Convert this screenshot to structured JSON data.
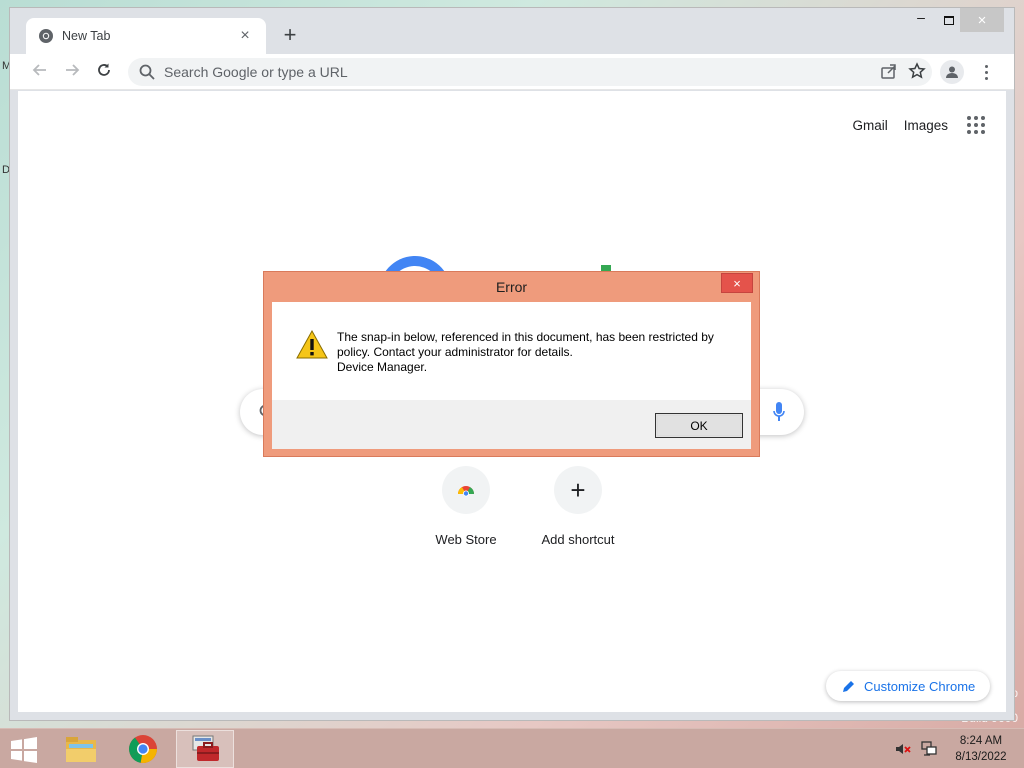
{
  "desktop": {
    "fragment_top": "M",
    "fragment_mid": "D",
    "watermark_side": "p",
    "watermark_build": "Build 9600"
  },
  "browser": {
    "tab_title": "New Tab",
    "tab_close": "×",
    "newtab_symbol": "+",
    "window_controls": {
      "minimize": "–",
      "close": "×"
    },
    "omnibox_placeholder": "Search Google or type a URL",
    "top_links": {
      "gmail": "Gmail",
      "images": "Images"
    },
    "shortcuts": [
      {
        "label": "Web Store"
      },
      {
        "label": "Add shortcut",
        "symbol": "+"
      }
    ],
    "customize_label": "Customize Chrome"
  },
  "dialog": {
    "title": "Error",
    "close_symbol": "×",
    "message_line1": "The snap-in below, referenced in this document, has been restricted by",
    "message_line2": "policy. Contact your administrator for details.",
    "message_line3": "Device Manager.",
    "ok_label": "OK"
  },
  "taskbar": {
    "items": [
      {
        "icon": "file-explorer-icon"
      },
      {
        "icon": "chrome-icon"
      },
      {
        "icon": "computer-management-icon",
        "active": true
      }
    ],
    "clock_time": "8:24 AM",
    "clock_date": "8/13/2022"
  },
  "colors": {
    "dialog_frame": "#ef9b7c",
    "dialog_close": "#e4534b",
    "taskbar": "#c9a8a1",
    "accent_blue": "#1a73e8"
  }
}
